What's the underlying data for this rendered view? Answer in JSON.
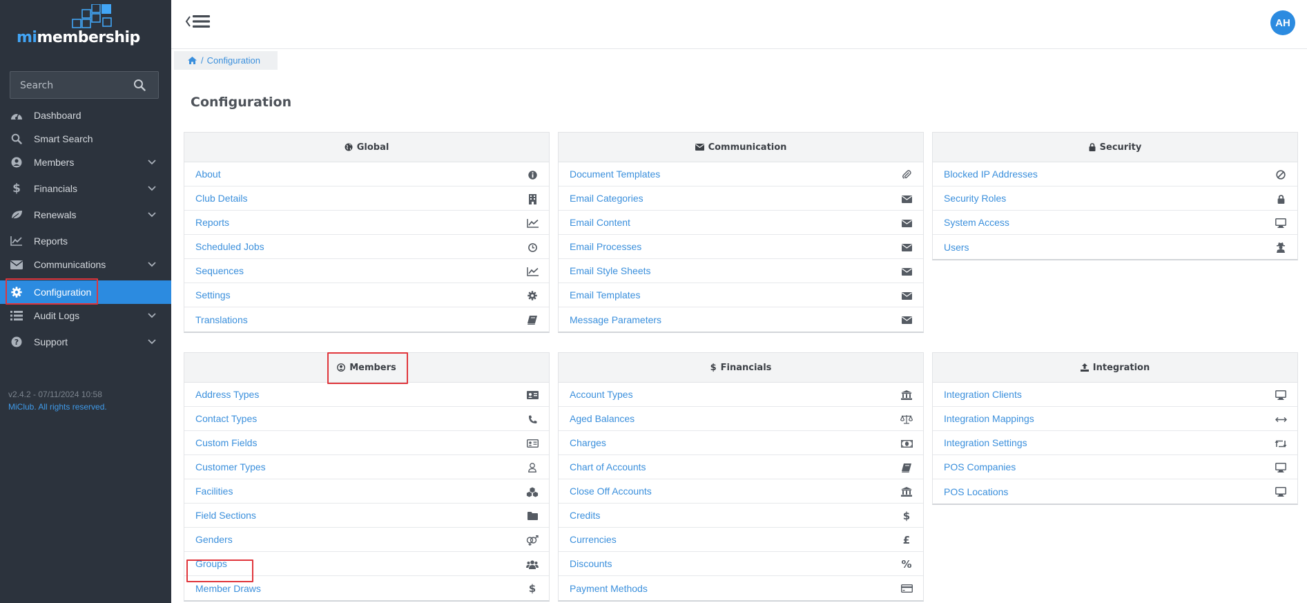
{
  "app": {
    "logo_prefix": "mi",
    "logo_suffix": "membership",
    "version": "v2.4.2 - 07/11/2024 10:58",
    "copyright": "MiClub. All rights reserved.",
    "accent_color": "#2c8be0",
    "sidebar_color": "#2c333d"
  },
  "search": {
    "placeholder": "Search"
  },
  "sidebar": {
    "items": [
      {
        "label": "Dashboard",
        "icon": "dashboard-icon",
        "expandable": false
      },
      {
        "label": "Smart Search",
        "icon": "search-icon",
        "expandable": false
      },
      {
        "label": "Members",
        "icon": "user-circle-icon",
        "expandable": true
      },
      {
        "label": "Financials",
        "icon": "dollar-icon",
        "expandable": true
      },
      {
        "label": "Renewals",
        "icon": "leaf-icon",
        "expandable": true
      },
      {
        "label": "Reports",
        "icon": "line-chart-icon",
        "expandable": false
      },
      {
        "label": "Communications",
        "icon": "envelope-icon",
        "expandable": true
      },
      {
        "label": "Configuration",
        "icon": "gear-icon",
        "expandable": false,
        "active": true
      },
      {
        "label": "Audit Logs",
        "icon": "list-icon",
        "expandable": true
      },
      {
        "label": "Support",
        "icon": "question-icon",
        "expandable": true
      }
    ]
  },
  "header": {
    "avatar_initials": "AH"
  },
  "breadcrumb": {
    "home_icon": "home-icon",
    "current": "Configuration"
  },
  "page": {
    "title": "Configuration"
  },
  "panels": {
    "global": {
      "title": "Global",
      "icon": "globe-icon",
      "items": [
        {
          "label": "About",
          "icon": "info-icon"
        },
        {
          "label": "Club Details",
          "icon": "building-icon"
        },
        {
          "label": "Reports",
          "icon": "line-chart-icon"
        },
        {
          "label": "Scheduled Jobs",
          "icon": "clock-icon"
        },
        {
          "label": "Sequences",
          "icon": "line-chart-icon"
        },
        {
          "label": "Settings",
          "icon": "gear-icon"
        },
        {
          "label": "Translations",
          "icon": "book-icon"
        }
      ]
    },
    "communication": {
      "title": "Communication",
      "icon": "envelope-icon",
      "items": [
        {
          "label": "Document Templates",
          "icon": "paperclip-icon"
        },
        {
          "label": "Email Categories",
          "icon": "envelope-icon"
        },
        {
          "label": "Email Content",
          "icon": "envelope-icon"
        },
        {
          "label": "Email Processes",
          "icon": "envelope-icon"
        },
        {
          "label": "Email Style Sheets",
          "icon": "envelope-icon"
        },
        {
          "label": "Email Templates",
          "icon": "envelope-icon"
        },
        {
          "label": "Message Parameters",
          "icon": "envelope-icon"
        }
      ]
    },
    "security": {
      "title": "Security",
      "icon": "lock-icon",
      "items": [
        {
          "label": "Blocked IP Addresses",
          "icon": "ban-icon"
        },
        {
          "label": "Security Roles",
          "icon": "lock-icon"
        },
        {
          "label": "System Access",
          "icon": "desktop-icon"
        },
        {
          "label": "Users",
          "icon": "user-secret-icon"
        }
      ]
    },
    "members": {
      "title": "Members",
      "icon": "user-circle-icon",
      "items": [
        {
          "label": "Address Types",
          "icon": "address-card-icon"
        },
        {
          "label": "Contact Types",
          "icon": "phone-icon"
        },
        {
          "label": "Custom Fields",
          "icon": "id-card-icon"
        },
        {
          "label": "Customer Types",
          "icon": "user-outline-icon"
        },
        {
          "label": "Facilities",
          "icon": "cubes-icon"
        },
        {
          "label": "Field Sections",
          "icon": "folder-icon"
        },
        {
          "label": "Genders",
          "icon": "genderless-icon"
        },
        {
          "label": "Groups",
          "icon": "users-icon"
        },
        {
          "label": "Member Draws",
          "icon": "dollar-icon"
        }
      ]
    },
    "financials": {
      "title": "Financials",
      "icon": "dollar-icon",
      "items": [
        {
          "label": "Account Types",
          "icon": "bank-icon"
        },
        {
          "label": "Aged Balances",
          "icon": "balance-scale-icon"
        },
        {
          "label": "Charges",
          "icon": "money-icon"
        },
        {
          "label": "Chart of Accounts",
          "icon": "book-icon"
        },
        {
          "label": "Close Off Accounts",
          "icon": "bank-icon"
        },
        {
          "label": "Credits",
          "icon": "dollar-icon"
        },
        {
          "label": "Currencies",
          "icon": "pound-icon"
        },
        {
          "label": "Discounts",
          "icon": "percent-icon"
        },
        {
          "label": "Payment Methods",
          "icon": "credit-card-icon"
        }
      ]
    },
    "integration": {
      "title": "Integration",
      "icon": "upload-icon",
      "items": [
        {
          "label": "Integration Clients",
          "icon": "desktop-icon"
        },
        {
          "label": "Integration Mappings",
          "icon": "arrows-h-icon"
        },
        {
          "label": "Integration Settings",
          "icon": "retweet-icon"
        },
        {
          "label": "POS Companies",
          "icon": "desktop-icon"
        },
        {
          "label": "POS Locations",
          "icon": "desktop-icon"
        }
      ]
    }
  }
}
